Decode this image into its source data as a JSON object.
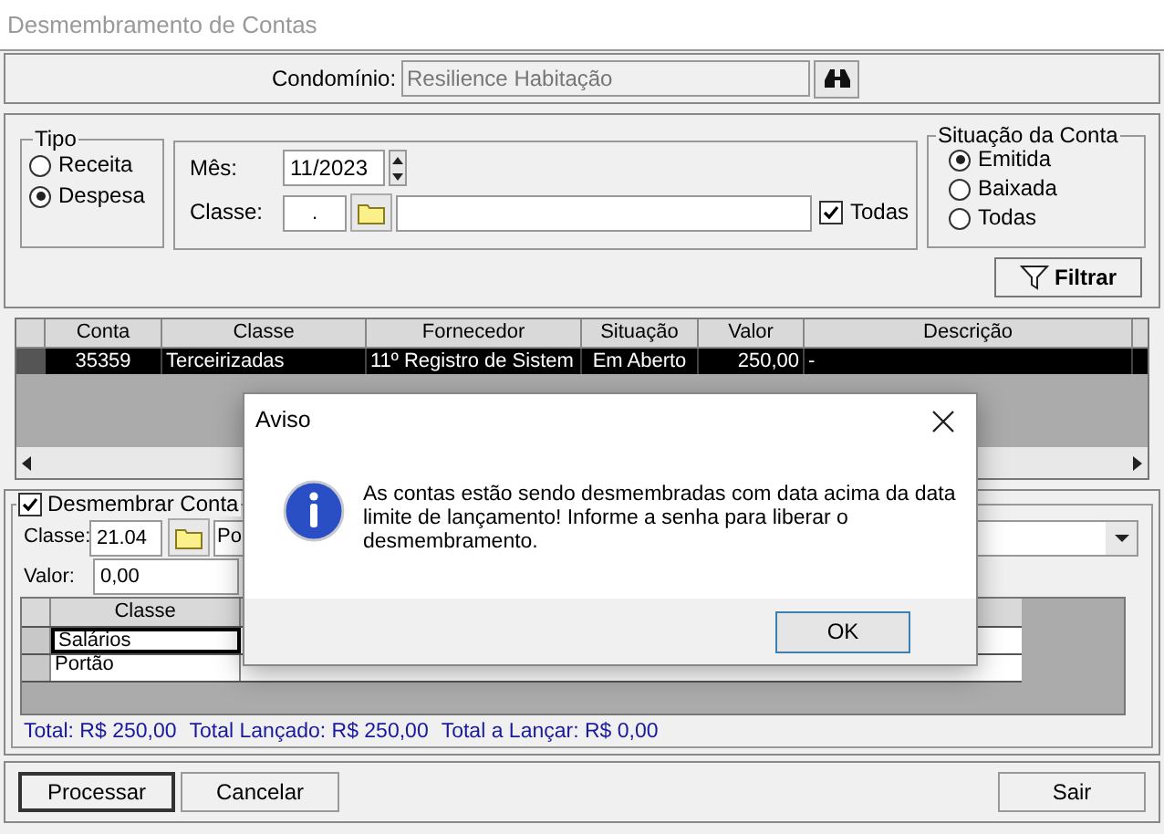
{
  "window": {
    "title": "Desmembramento de Contas"
  },
  "condominio": {
    "label": "Condomínio:",
    "value": "Resilience Habitação"
  },
  "tipo": {
    "title": "Tipo",
    "options": [
      {
        "label": "Receita",
        "selected": false
      },
      {
        "label": "Despesa",
        "selected": true
      }
    ]
  },
  "filters": {
    "mes_label": "Mês:",
    "mes_value": "11/2023",
    "classe_label": "Classe:",
    "classe_code": ".",
    "todas": {
      "label": "Todas",
      "checked": true
    }
  },
  "situacao": {
    "title": "Situação da Conta",
    "options": [
      {
        "label": "Emitida",
        "selected": true
      },
      {
        "label": "Baixada",
        "selected": false
      },
      {
        "label": "Todas",
        "selected": false
      }
    ]
  },
  "filter_button": "Filtrar",
  "accounts_table": {
    "columns": [
      "Conta",
      "Classe",
      "Fornecedor",
      "Situação",
      "Valor",
      "Descrição"
    ],
    "rows": [
      {
        "selected": true,
        "cells": [
          "35359",
          "Terceirizadas",
          "11º Registro de Sistem",
          "Em Aberto",
          "250,00",
          "-"
        ]
      }
    ]
  },
  "desmembrar": {
    "label": "Desmembrar Conta",
    "checked": true,
    "classe_label": "Classe:",
    "classe_code": "21.04",
    "classe_name": "Po",
    "valor_label": "Valor:",
    "valor": "0,00"
  },
  "split_table": {
    "columns": [
      "Classe"
    ],
    "rows": [
      {
        "classe": "Salários",
        "selected": true
      },
      {
        "classe": "Portão",
        "selected": false
      }
    ]
  },
  "totals": [
    "Total: R$ 250,00",
    "Total Lançado: R$ 250,00",
    "Total a Lançar: R$ 0,00"
  ],
  "buttons": [
    {
      "label": "Processar",
      "default": true
    },
    {
      "label": "Cancelar",
      "default": false
    },
    {
      "label": "Sair",
      "default": false
    }
  ],
  "dialog": {
    "title": "Aviso",
    "message": "As contas estão sendo desmembradas com data acima da data limite de lançamento! Informe a senha para liberar o desmembramento.",
    "button": "OK"
  }
}
